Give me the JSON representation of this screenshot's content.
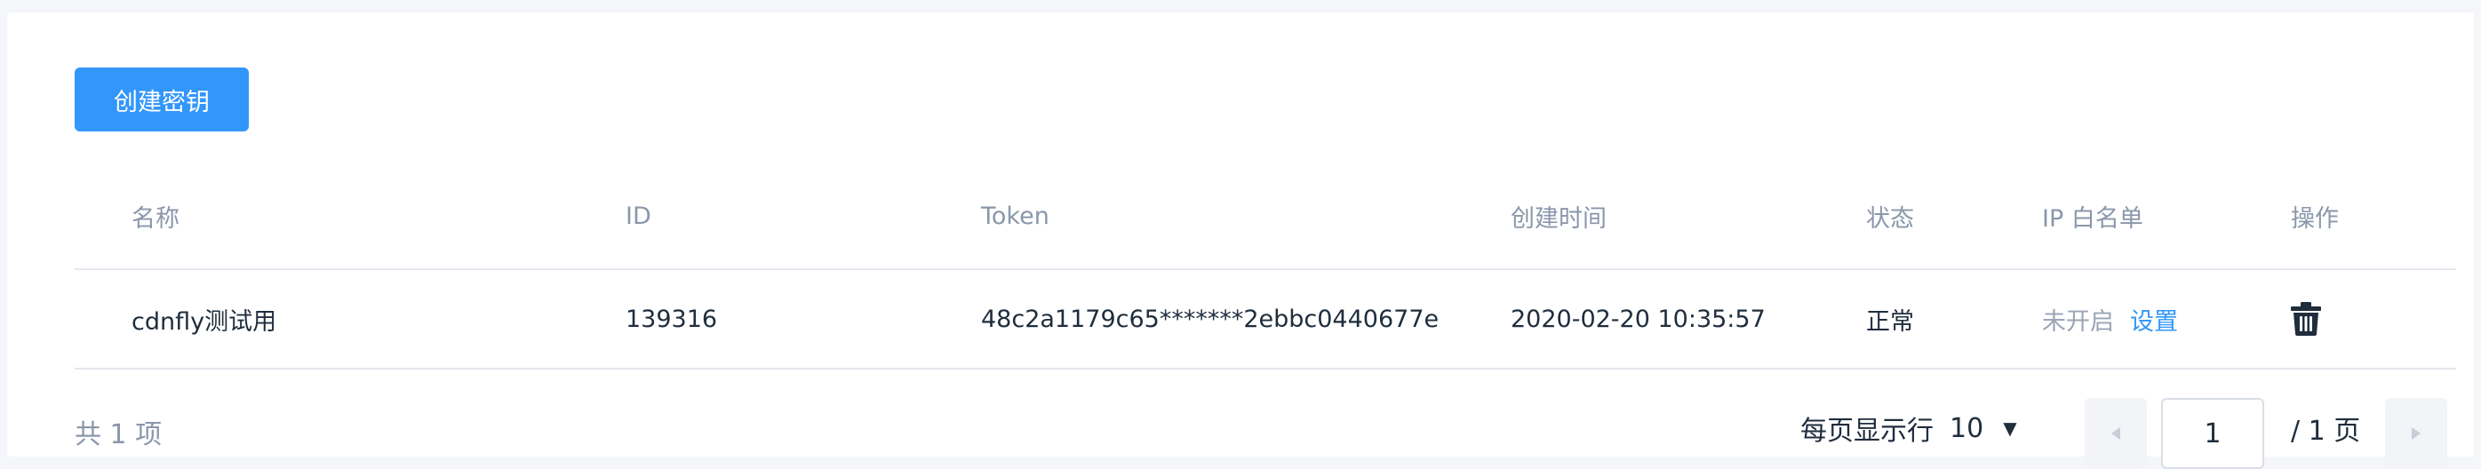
{
  "toolbar": {
    "create_label": "创建密钥"
  },
  "table": {
    "headers": {
      "name": "名称",
      "id": "ID",
      "token": "Token",
      "created": "创建时间",
      "status": "状态",
      "ip_whitelist": "IP 白名单",
      "actions": "操作"
    },
    "rows": [
      {
        "name": "cdnfly测试用",
        "id": "139316",
        "token": "48c2a1179c65*******2ebbc0440677e",
        "created": "2020-02-20 10:35:57",
        "status": "正常",
        "ip_status": "未开启",
        "ip_action": "设置",
        "delete_icon": "trash-icon"
      }
    ]
  },
  "pagination": {
    "total": "共 1 项",
    "per_page_label": "每页显示行",
    "per_page_value": "10",
    "current_page": "1",
    "total_pages": "/ 1 页"
  },
  "colors": {
    "accent": "#3296fa",
    "muted": "#8a97ab",
    "text": "#1f2d3d"
  }
}
